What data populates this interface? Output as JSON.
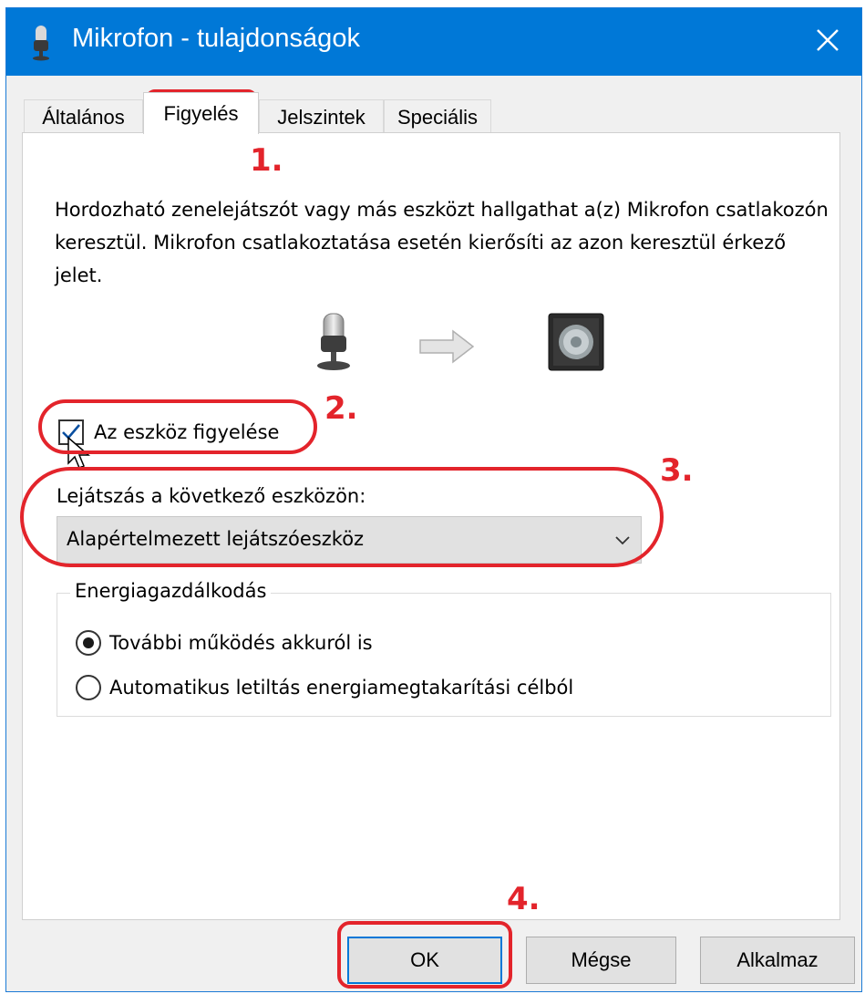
{
  "window": {
    "title": "Mikrofon - tulajdonságok",
    "accent_color": "#0078d7",
    "title_icon": "microphone-icon",
    "close_icon": "close-icon"
  },
  "tabs": [
    {
      "label": "Általános",
      "active": false
    },
    {
      "label": "Figyelés",
      "active": true
    },
    {
      "label": "Jelszintek",
      "active": false
    },
    {
      "label": "Speciális",
      "active": false
    }
  ],
  "listen": {
    "description": "Hordozható zenelejátszót vagy más eszközt hallgathat a(z) Mikrofon csatlakozón keresztül. Mikrofon csatlakoztatása esetén kierősíti az azon keresztül érkező jelet.",
    "illustration_icons": [
      "microphone-icon",
      "arrow-right-icon",
      "speaker-icon"
    ],
    "checkbox_label": "Az eszköz figyelése",
    "checkbox_checked": true,
    "playback_label": "Lejátszás a következő eszközön:",
    "playback_value": "Alapértelmezett lejátszóeszköz"
  },
  "power": {
    "title": "Energiagazdálkodás",
    "options": [
      {
        "label": "További működés akkuról is",
        "selected": true
      },
      {
        "label": "Automatikus letiltás energiamegtakarítási célból",
        "selected": false
      }
    ]
  },
  "buttons": {
    "ok": "OK",
    "cancel": "Mégse",
    "apply": "Alkalmaz"
  },
  "annotations": {
    "color": "#e3242b",
    "labels": [
      "1.",
      "2.",
      "3.",
      "4."
    ]
  }
}
